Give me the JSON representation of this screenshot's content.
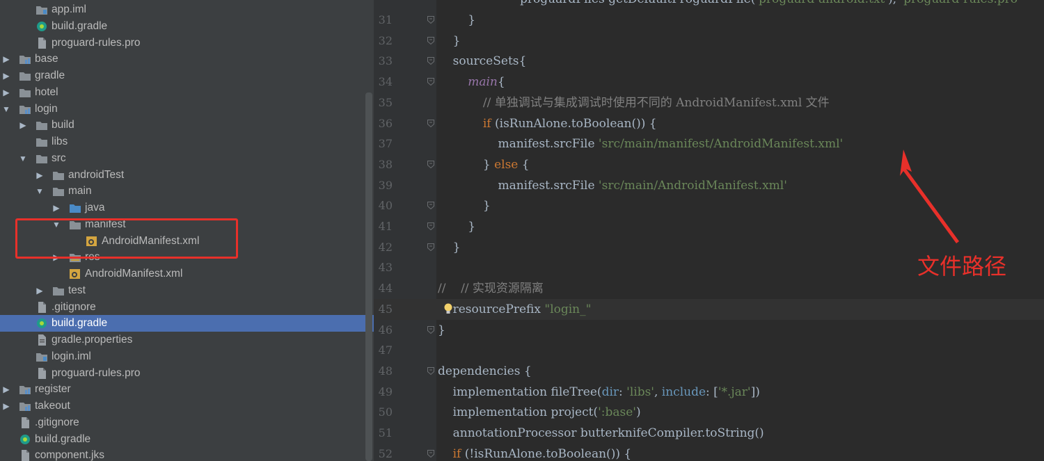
{
  "tree": {
    "rows": [
      {
        "label": "app.iml",
        "icon": "iml-icon",
        "indent": 2,
        "arrow": ""
      },
      {
        "label": "build.gradle",
        "icon": "gradle-icon",
        "indent": 2,
        "arrow": ""
      },
      {
        "label": "proguard-rules.pro",
        "icon": "file-icon",
        "indent": 2,
        "arrow": ""
      },
      {
        "label": "base",
        "icon": "module-icon",
        "indent": 1,
        "arrow": "right"
      },
      {
        "label": "gradle",
        "icon": "folder-icon",
        "indent": 1,
        "arrow": "right"
      },
      {
        "label": "hotel",
        "icon": "folder-icon",
        "indent": 1,
        "arrow": "right"
      },
      {
        "label": "login",
        "icon": "module-icon",
        "indent": 1,
        "arrow": "down"
      },
      {
        "label": "build",
        "icon": "folder-icon",
        "indent": 2,
        "arrow": "right"
      },
      {
        "label": "libs",
        "icon": "folder-icon",
        "indent": 2,
        "arrow": ""
      },
      {
        "label": "src",
        "icon": "folder-icon",
        "indent": 2,
        "arrow": "down"
      },
      {
        "label": "androidTest",
        "icon": "folder-icon",
        "indent": 3,
        "arrow": "right"
      },
      {
        "label": "main",
        "icon": "folder-icon",
        "indent": 3,
        "arrow": "down"
      },
      {
        "label": "java",
        "icon": "source-folder-icon",
        "indent": 4,
        "arrow": "right"
      },
      {
        "label": "manifest",
        "icon": "folder-icon",
        "indent": 4,
        "arrow": "down"
      },
      {
        "label": "AndroidManifest.xml",
        "icon": "manifest-icon",
        "indent": 5,
        "arrow": ""
      },
      {
        "label": "res",
        "icon": "res-folder-icon",
        "indent": 4,
        "arrow": "right"
      },
      {
        "label": "AndroidManifest.xml",
        "icon": "manifest-icon",
        "indent": 4,
        "arrow": ""
      },
      {
        "label": "test",
        "icon": "folder-icon",
        "indent": 3,
        "arrow": "right"
      },
      {
        "label": ".gitignore",
        "icon": "file-icon",
        "indent": 2,
        "arrow": ""
      },
      {
        "label": "build.gradle",
        "icon": "gradle-icon",
        "indent": 2,
        "arrow": "",
        "selected": true
      },
      {
        "label": "gradle.properties",
        "icon": "properties-icon",
        "indent": 2,
        "arrow": ""
      },
      {
        "label": "login.iml",
        "icon": "iml-icon",
        "indent": 2,
        "arrow": ""
      },
      {
        "label": "proguard-rules.pro",
        "icon": "file-icon",
        "indent": 2,
        "arrow": ""
      },
      {
        "label": "register",
        "icon": "module-icon",
        "indent": 1,
        "arrow": "right"
      },
      {
        "label": "takeout",
        "icon": "module-icon",
        "indent": 1,
        "arrow": "right"
      },
      {
        "label": ".gitignore",
        "icon": "file-icon",
        "indent": 1,
        "arrow": ""
      },
      {
        "label": "build.gradle",
        "icon": "gradle-icon",
        "indent": 1,
        "arrow": ""
      },
      {
        "label": "component.jks",
        "icon": "file-icon",
        "indent": 1,
        "arrow": ""
      }
    ]
  },
  "editor": {
    "first_line_partial": "proguardFiles getDefaultProguardFile('proguard-android.txt'), 'proguard-rules.pro'",
    "lines": [
      {
        "n": "31",
        "html": "        }"
      },
      {
        "n": "32",
        "html": "    }"
      },
      {
        "n": "33",
        "html": "    sourceSets{"
      },
      {
        "n": "34",
        "html": "        main{"
      },
      {
        "n": "35",
        "html": "            // 单独调试与集成调试时使用不同的 AndroidManifest.xml 文件"
      },
      {
        "n": "36",
        "html": "            if (isRunAlone.toBoolean()) {"
      },
      {
        "n": "37",
        "html": "                manifest.srcFile 'src/main/manifest/AndroidManifest.xml'"
      },
      {
        "n": "38",
        "html": "            } else {"
      },
      {
        "n": "39",
        "html": "                manifest.srcFile 'src/main/AndroidManifest.xml'"
      },
      {
        "n": "40",
        "html": "            }"
      },
      {
        "n": "41",
        "html": "        }"
      },
      {
        "n": "42",
        "html": "    }"
      },
      {
        "n": "43",
        "html": ""
      },
      {
        "n": "44",
        "html": "//    // 实现资源隔离"
      },
      {
        "n": "45",
        "html": "    resourcePrefix \"login_\""
      },
      {
        "n": "46",
        "html": "}"
      },
      {
        "n": "47",
        "html": ""
      },
      {
        "n": "48",
        "html": "dependencies {"
      },
      {
        "n": "49",
        "html": "    implementation fileTree(dir: 'libs', include: ['*.jar'])"
      },
      {
        "n": "50",
        "html": "    implementation project(':base')"
      },
      {
        "n": "51",
        "html": "    annotationProcessor butterknifeCompiler.toString()"
      },
      {
        "n": "52",
        "html": "    if (!isRunAlone.toBoolean()) {"
      }
    ]
  },
  "annotation": {
    "label": "文件路径",
    "color": "#e8302a"
  }
}
